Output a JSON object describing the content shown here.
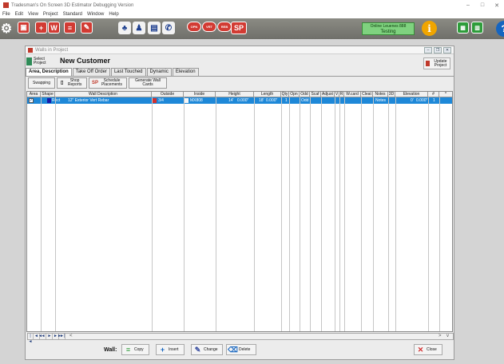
{
  "window": {
    "title": "Tradesman's On Screen 3D Estimator Debugging Version",
    "min_label": "–",
    "max_label": "□",
    "close_label": "✕"
  },
  "menu": [
    "File",
    "Edit",
    "View",
    "Project",
    "Standard",
    "Window",
    "Help"
  ],
  "toolbar": {
    "gear_icon": "⚙",
    "opn_label": "OPN",
    "vrt_label": "VRT",
    "reb_label": "REB",
    "sp_label": "SP",
    "online_line1": "Online Leuenes 888",
    "online_line2": "Testing",
    "info_label": "i",
    "help_label": "?"
  },
  "child": {
    "title": "Walls in Project",
    "min_label": "–",
    "restore_label": "❐",
    "close_label": "✕",
    "select_project_label": "Select Project",
    "customer_name": "New Customer",
    "update_project_label": "Update Project",
    "tabs": [
      "Area, Description",
      "Take Off Order",
      "Last Touched",
      "Dynamic",
      "Elevation"
    ],
    "sub_buttons": [
      "Swapping",
      "Shop Reports",
      "Schedule Placements",
      "Generate Wall Cards"
    ],
    "sp_badge": "SP"
  },
  "grid": {
    "columns": [
      "Area",
      "Shape",
      "Wall Description",
      "Outside",
      "Inside",
      "Height",
      "Length",
      "Qty",
      "Opn",
      "Odd",
      "Scaf",
      "Adjust",
      "V",
      "R",
      "W.card",
      "Cleat",
      "Notes",
      "3D",
      "Elevation",
      "#",
      "^"
    ],
    "rows": [
      {
        "area": "✓",
        "shape": "Rect",
        "description": "12\" Exterior Vert Rebar",
        "outside": "3/4",
        "inside": "MX808",
        "height_ft": "14'",
        "height_in": "0.000\"",
        "length_ft": "18'",
        "length_in": "0.000\"",
        "qty": "1",
        "odd": "Odd",
        "notes": "Notes",
        "elevation_ft": "0'",
        "elevation_in": "0.000\"",
        "num": "1"
      }
    ],
    "colors": {
      "selected_row": "#1e88d8",
      "shape_swatch": "#1a1aa8",
      "outside_swatch": "#d32f2f",
      "inside_swatch": "#f5f5f5"
    }
  },
  "navigator": [
    "|◄",
    "◄◄",
    "◄",
    "►",
    "►►",
    "►|"
  ],
  "scroll": {
    "left": "<",
    "right": ">",
    "down": "v"
  },
  "bottom": {
    "wall_label": "Wall:",
    "copy_label": "Copy",
    "insert_label": "Insert",
    "change_label": "Change",
    "delete_label": "Delete",
    "close_label": "Close"
  }
}
